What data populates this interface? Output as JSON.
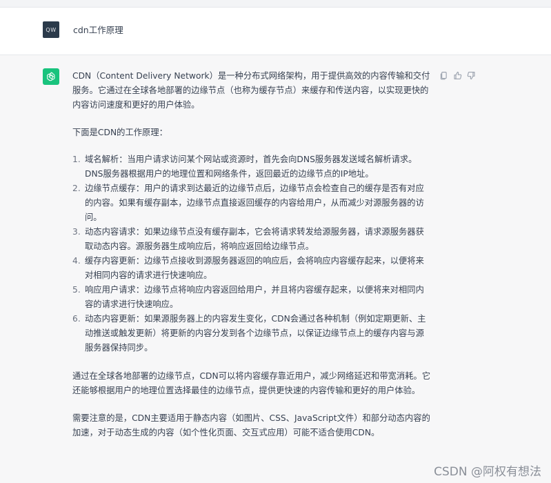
{
  "user_message": {
    "avatar_initials": "QW",
    "text": "cdn工作原理"
  },
  "assistant_message": {
    "intro": "CDN（Content Delivery Network）是一种分布式网络架构，用于提供高效的内容传输和交付服务。它通过在全球各地部署的边缘节点（也称为缓存节点）来缓存和传送内容，以实现更快的内容访问速度和更好的用户体验。",
    "lead_in": "下面是CDN的工作原理：",
    "steps": [
      {
        "num": "1.",
        "text": "域名解析：当用户请求访问某个网站或资源时，首先会向DNS服务器发送域名解析请求。DNS服务器根据用户的地理位置和网络条件，返回最近的边缘节点的IP地址。"
      },
      {
        "num": "2.",
        "text": "边缘节点缓存：用户的请求到达最近的边缘节点后，边缘节点会检查自己的缓存是否有对应的内容。如果有缓存副本，边缘节点直接返回缓存的内容给用户，从而减少对源服务器的访问。"
      },
      {
        "num": "3.",
        "text": "动态内容请求：如果边缘节点没有缓存副本，它会将请求转发给源服务器，请求源服务器获取动态内容。源服务器生成响应后，将响应返回给边缘节点。"
      },
      {
        "num": "4.",
        "text": "缓存内容更新：边缘节点接收到源服务器返回的响应后，会将响应内容缓存起来，以便将来对相同内容的请求进行快速响应。"
      },
      {
        "num": "5.",
        "text": "响应用户请求：边缘节点将响应内容返回给用户，并且将内容缓存起来，以便将来对相同内容的请求进行快速响应。"
      },
      {
        "num": "6.",
        "text": "动态内容更新：如果源服务器上的内容发生变化，CDN会通过各种机制（例如定期更新、主动推送或触发更新）将更新的内容分发到各个边缘节点，以保证边缘节点上的缓存内容与源服务器保持同步。"
      }
    ],
    "summary": "通过在全球各地部署的边缘节点，CDN可以将内容缓存靠近用户，减少网络延迟和带宽消耗。它还能够根据用户的地理位置选择最佳的边缘节点，提供更快速的内容传输和更好的用户体验。",
    "note": "需要注意的是，CDN主要适用于静态内容（如图片、CSS、JavaScript文件）和部分动态内容的加速，对于动态生成的内容（如个性化页面、交互式应用）可能不适合使用CDN。"
  },
  "actions": {
    "icons": [
      "copy-icon",
      "thumbs-up-icon",
      "thumbs-down-icon"
    ]
  },
  "watermark": "CSDN @阿权有想法",
  "colors": {
    "assistant_bg": "#f7f7f8",
    "bot_avatar": "#19c37d",
    "user_avatar": "#2b3a4a",
    "text": "#374151"
  }
}
